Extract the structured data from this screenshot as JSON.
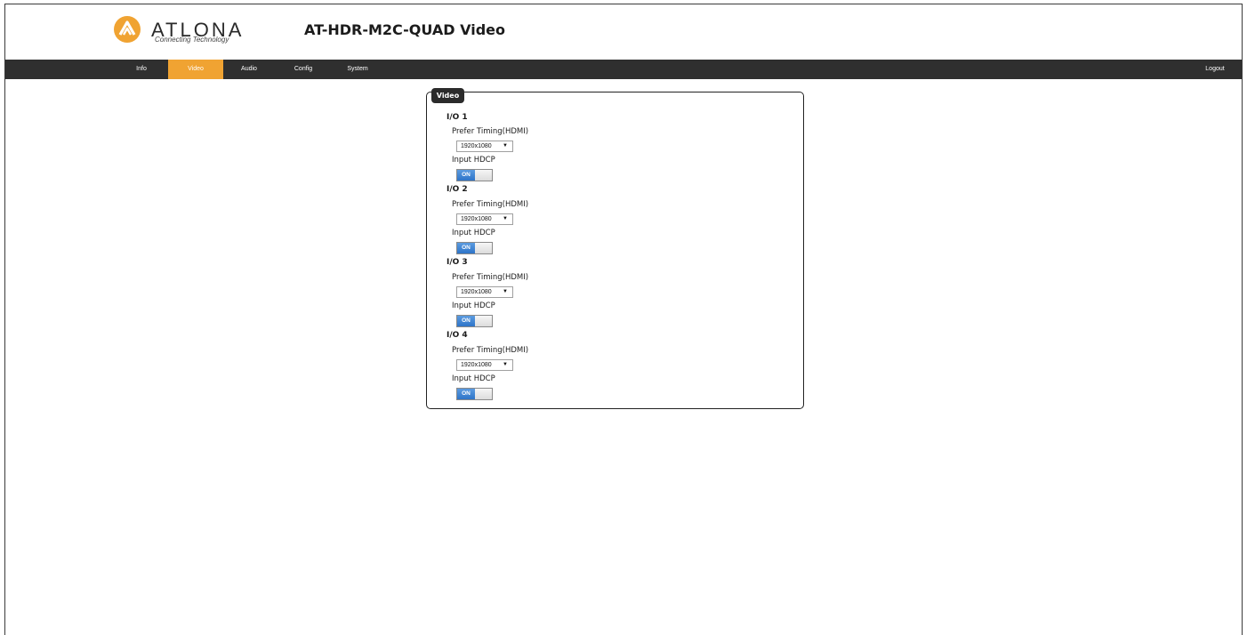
{
  "header": {
    "brand": "ATLONA",
    "tagline": "Connecting Technology",
    "title": "AT-HDR-M2C-QUAD  Video"
  },
  "nav": {
    "items": [
      "Info",
      "Video",
      "Audio",
      "Config",
      "System"
    ],
    "active": "Video",
    "logout": "Logout"
  },
  "panel": {
    "title": "Video",
    "io": [
      {
        "label": "I/O 1",
        "timing_label": "Prefer Timing(HDMI)",
        "timing_value": "1920x1080",
        "hdcp_label": "Input HDCP",
        "hdcp_state": "ON"
      },
      {
        "label": "I/O 2",
        "timing_label": "Prefer Timing(HDMI)",
        "timing_value": "1920x1080",
        "hdcp_label": "Input HDCP",
        "hdcp_state": "ON"
      },
      {
        "label": "I/O 3",
        "timing_label": "Prefer Timing(HDMI)",
        "timing_value": "1920x1080",
        "hdcp_label": "Input HDCP",
        "hdcp_state": "ON"
      },
      {
        "label": "I/O 4",
        "timing_label": "Prefer Timing(HDMI)",
        "timing_value": "1920x1080",
        "hdcp_label": "Input HDCP",
        "hdcp_state": "ON"
      }
    ]
  },
  "colors": {
    "accent": "#f0a332",
    "navbar": "#2f2f2f",
    "toggle_on": "#2e74c8"
  }
}
